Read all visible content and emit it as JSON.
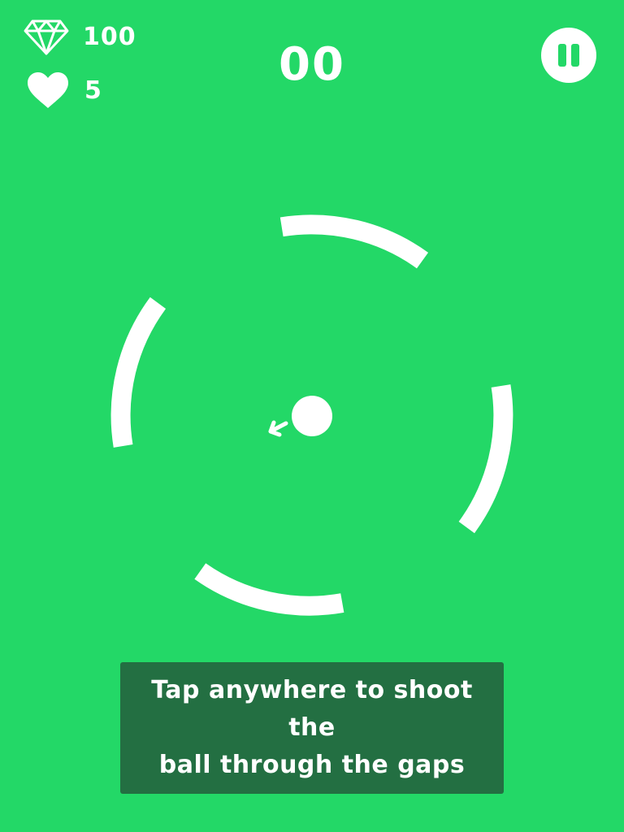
{
  "hud": {
    "gems": "100",
    "lives": "5",
    "score": "00",
    "gem_icon": "diamond-icon",
    "lives_icon": "heart-icon",
    "pause_icon": "pause-icon"
  },
  "tutorial": {
    "line1": "Tap anywhere to shoot the",
    "line2": "ball through the gaps"
  },
  "colors": {
    "background": "#23d867",
    "foreground": "#ffffff",
    "tutorial_panel": "#236f42"
  }
}
